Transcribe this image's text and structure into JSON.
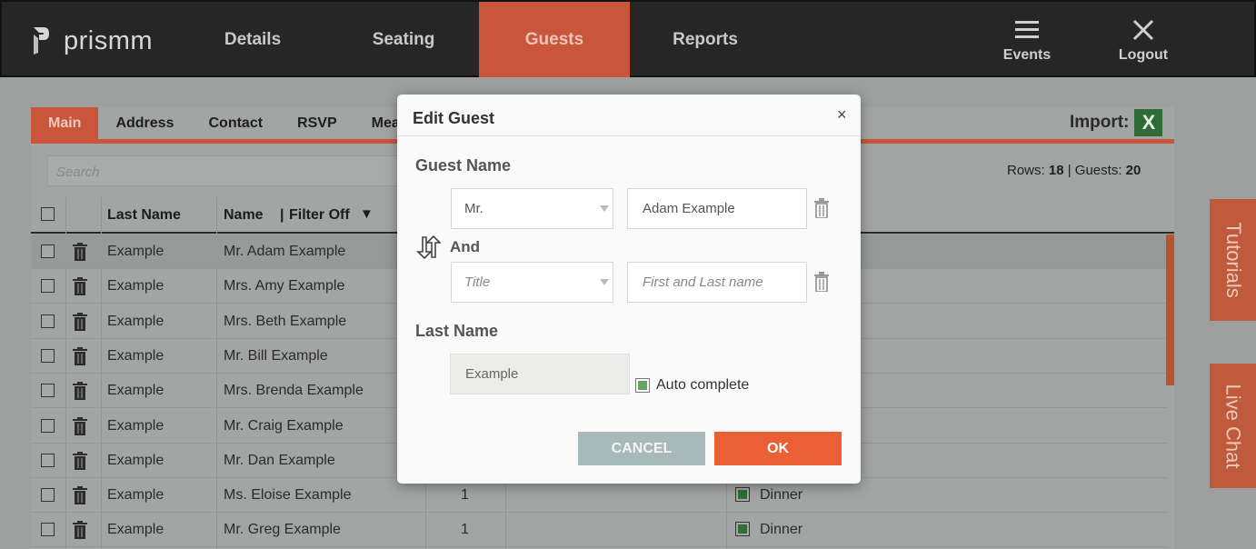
{
  "app": {
    "logo_text": "prismm"
  },
  "nav": {
    "tabs": [
      {
        "label": "Details"
      },
      {
        "label": "Seating"
      },
      {
        "label": "Guests"
      },
      {
        "label": "Reports"
      }
    ],
    "events_label": "Events",
    "logout_label": "Logout"
  },
  "subtabs": [
    "Main",
    "Address",
    "Contact",
    "RSVP",
    "Mea"
  ],
  "import_label": "Import:",
  "search_placeholder": "Search",
  "rows_info": {
    "rows_label": "Rows:",
    "rows": "18",
    "sep": "|",
    "guests_label": "Guests:",
    "guests": "20"
  },
  "table": {
    "headers": {
      "last_name": "Last Name",
      "name": "Name",
      "filter": "Filter Off"
    },
    "rows": [
      {
        "last": "Example",
        "name": "Mr. Adam Example",
        "count": "",
        "meal": ""
      },
      {
        "last": "Example",
        "name": "Mrs. Amy Example",
        "count": "",
        "meal": ""
      },
      {
        "last": "Example",
        "name": "Mrs. Beth Example",
        "count": "",
        "meal": ""
      },
      {
        "last": "Example",
        "name": "Mr. Bill Example",
        "count": "",
        "meal": ""
      },
      {
        "last": "Example",
        "name": "Mrs. Brenda Example",
        "count": "",
        "meal": ""
      },
      {
        "last": "Example",
        "name": "Mr. Craig Example",
        "count": "",
        "meal": ""
      },
      {
        "last": "Example",
        "name": "Mr. Dan Example",
        "count": "",
        "meal": ""
      },
      {
        "last": "Example",
        "name": "Ms. Eloise Example",
        "count": "1",
        "meal": "Dinner"
      },
      {
        "last": "Example",
        "name": "Mr. Greg Example",
        "count": "1",
        "meal": "Dinner"
      }
    ]
  },
  "side": {
    "tutorials": "Tutorials",
    "live_chat": "Live Chat"
  },
  "modal": {
    "title": "Edit Guest",
    "close": "×",
    "guest_name_label": "Guest Name",
    "title1": "Mr.",
    "name1": "Adam Example",
    "and_label": "And",
    "title2_placeholder": "Title",
    "name2_placeholder": "First and Last name",
    "last_name_label": "Last Name",
    "last_name_value": "Example",
    "auto_complete_label": "Auto complete",
    "auto_complete_checked": true,
    "cancel_label": "CANCEL",
    "ok_label": "OK"
  }
}
